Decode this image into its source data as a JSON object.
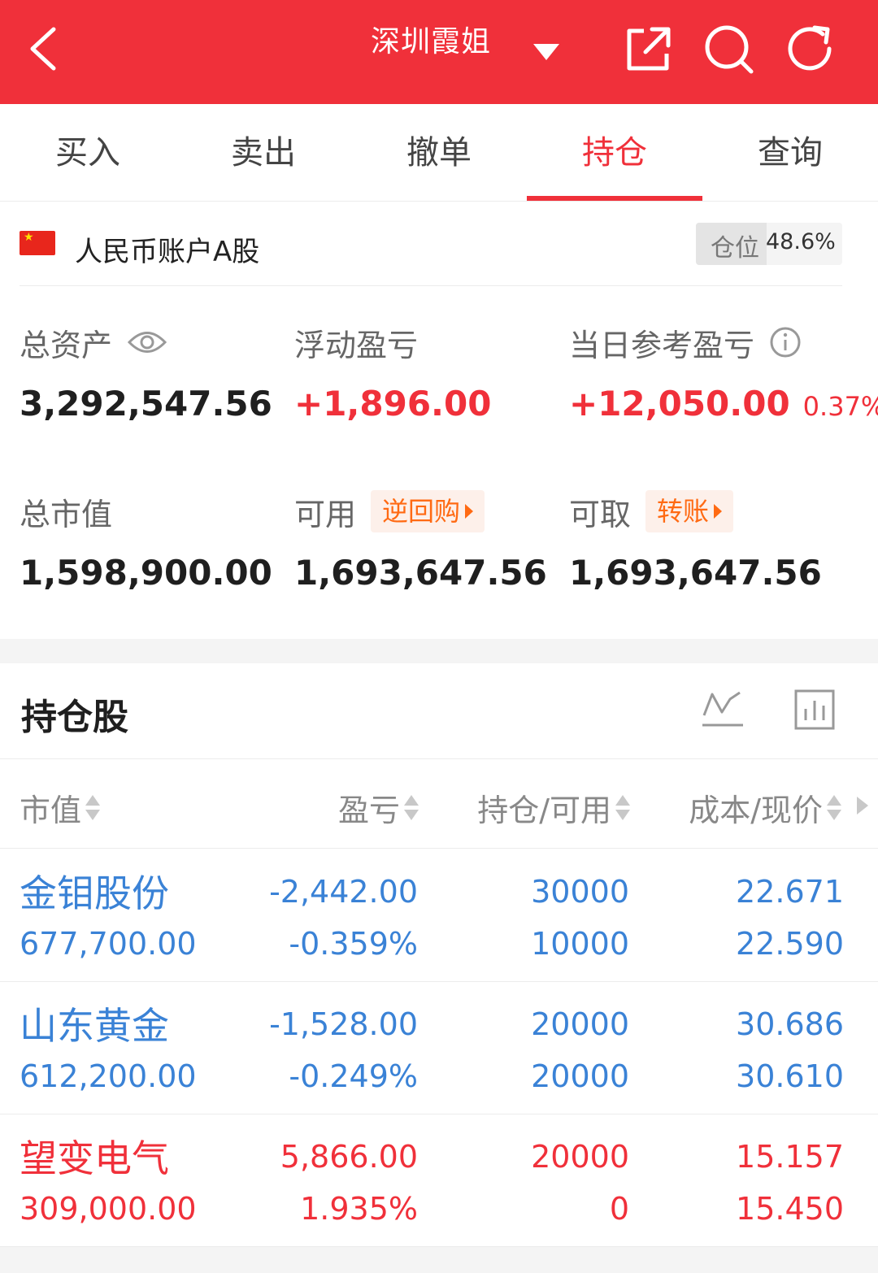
{
  "header": {
    "title": "深圳霞姐",
    "bar_color": "#f0303a",
    "icons": [
      "back-icon",
      "dropdown-icon",
      "share-icon",
      "search-icon",
      "refresh-icon"
    ]
  },
  "tabs": [
    {
      "label": "买入",
      "active": false
    },
    {
      "label": "卖出",
      "active": false
    },
    {
      "label": "撤单",
      "active": false
    },
    {
      "label": "持仓",
      "active": true
    },
    {
      "label": "查询",
      "active": false
    }
  ],
  "account": {
    "name": "人民币账户A股",
    "position_label": "仓位",
    "position_value": "48.6%",
    "position_fraction": 0.486
  },
  "summary": {
    "total_assets": {
      "label": "总资产",
      "value": "3,292,547.56"
    },
    "floating_pnl": {
      "label": "浮动盈亏",
      "value": "+1,896.00"
    },
    "daily_pnl": {
      "label": "当日参考盈亏",
      "value": "+12,050.00",
      "pct": "0.37%"
    },
    "market_value": {
      "label": "总市值",
      "value": "1,598,900.00"
    },
    "available": {
      "label": "可用",
      "tag": "逆回购",
      "value": "1,693,647.56"
    },
    "withdrawable": {
      "label": "可取",
      "tag": "转账",
      "value": "1,693,647.56"
    }
  },
  "holdings": {
    "title": "持仓股",
    "columns": [
      "市值",
      "盈亏",
      "持仓/可用",
      "成本/现价"
    ],
    "rows": [
      {
        "name": "金钼股份",
        "market_value": "677,700.00",
        "pnl": "-2,442.00",
        "pnl_pct": "-0.359%",
        "holding": "30000",
        "available": "10000",
        "cost": "22.671",
        "price": "22.590",
        "color": "#3a82d6"
      },
      {
        "name": "山东黄金",
        "market_value": "612,200.00",
        "pnl": "-1,528.00",
        "pnl_pct": "-0.249%",
        "holding": "20000",
        "available": "20000",
        "cost": "30.686",
        "price": "30.610",
        "color": "#3a82d6"
      },
      {
        "name": "望变电气",
        "market_value": "309,000.00",
        "pnl": "5,866.00",
        "pnl_pct": "1.935%",
        "holding": "20000",
        "available": "0",
        "cost": "15.157",
        "price": "15.450",
        "color": "#f0303a"
      }
    ]
  }
}
